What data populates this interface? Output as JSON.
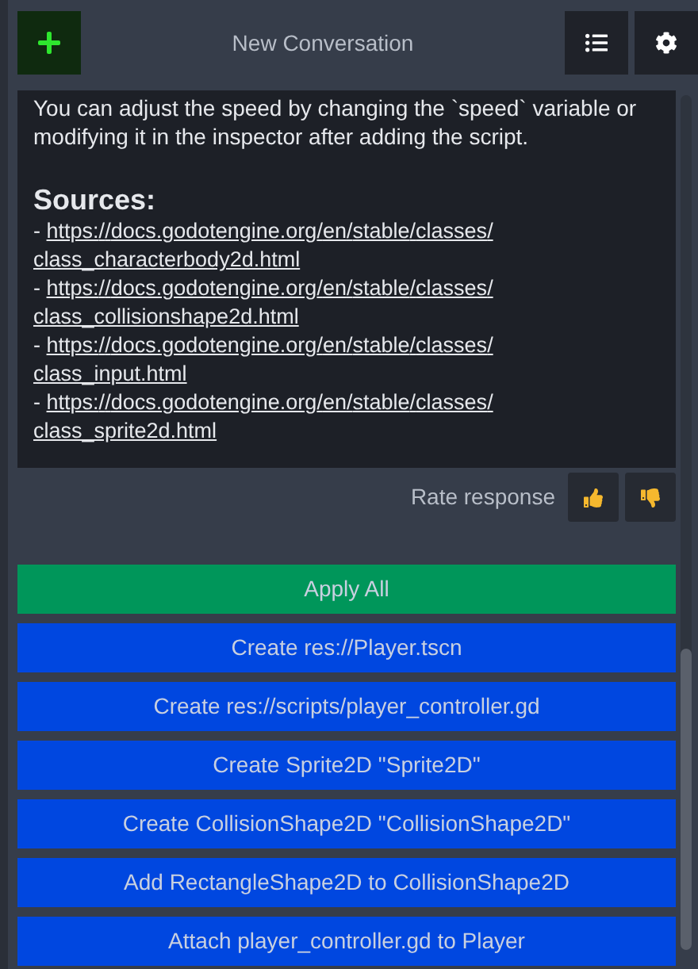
{
  "header": {
    "title": "New Conversation"
  },
  "message": {
    "paragraph": "You can adjust the speed by changing the `speed` variable or modifying it in the inspector after adding the script.",
    "sources_heading": "Sources:",
    "sources": [
      {
        "bullet": "-",
        "url": "https://docs.godotengine.org/en/stable/classes/class_characterbody2d.html"
      },
      {
        "bullet": "-",
        "url": "https://docs.godotengine.org/en/stable/classes/class_collisionshape2d.html"
      },
      {
        "bullet": "-",
        "url": "https://docs.godotengine.org/en/stable/classes/class_input.html"
      },
      {
        "bullet": "-",
        "url": "https://docs.godotengine.org/en/stable/classes/class_sprite2d.html"
      }
    ]
  },
  "rating": {
    "label": "Rate response"
  },
  "actions": [
    {
      "kind": "apply",
      "label": "Apply All"
    },
    {
      "kind": "step",
      "label": "Create res://Player.tscn"
    },
    {
      "kind": "step",
      "label": "Create res://scripts/player_controller.gd"
    },
    {
      "kind": "step",
      "label": "Create Sprite2D \"Sprite2D\""
    },
    {
      "kind": "step",
      "label": "Create CollisionShape2D \"CollisionShape2D\""
    },
    {
      "kind": "step",
      "label": "Add RectangleShape2D to CollisionShape2D"
    },
    {
      "kind": "step",
      "label": "Attach player_controller.gd to Player"
    }
  ]
}
